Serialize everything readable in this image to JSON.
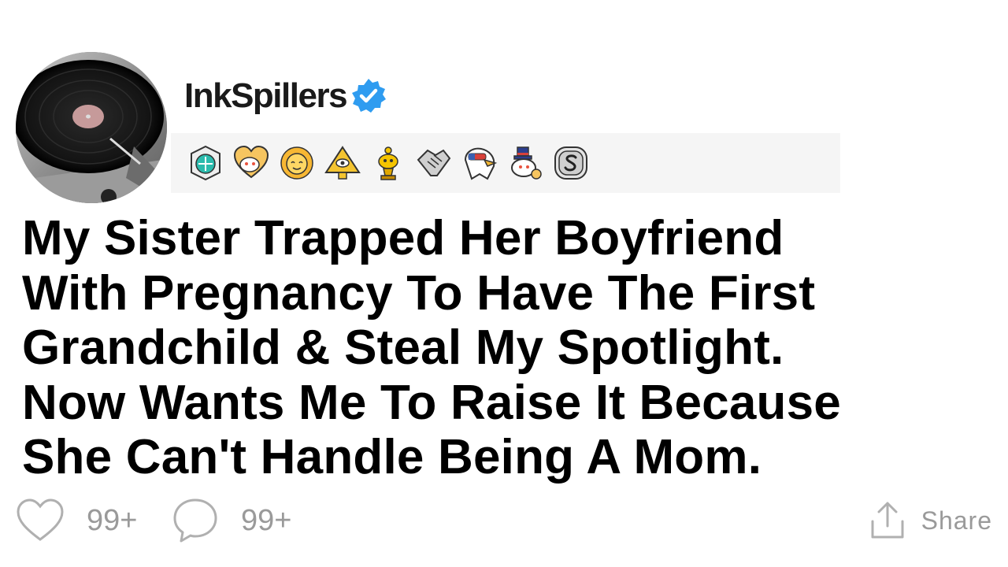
{
  "post": {
    "author": {
      "username": "InkSpillers",
      "verified": true,
      "avatar_icon": "record-player-avatar"
    },
    "awards": [
      {
        "name": "helpful-award-icon"
      },
      {
        "name": "wholesome-heart-award-icon"
      },
      {
        "name": "happy-sun-award-icon"
      },
      {
        "name": "illuminati-pyramid-award-icon"
      },
      {
        "name": "gold-trophy-award-icon"
      },
      {
        "name": "handshake-award-icon"
      },
      {
        "name": "eagle-award-icon"
      },
      {
        "name": "snoo-top-hat-award-icon"
      },
      {
        "name": "silver-coin-award-icon"
      }
    ],
    "title_lines": [
      "My Sister Trapped Her Boyfriend",
      "With Pregnancy To Have The First",
      "Grandchild & Steal My Spotlight.",
      "Now Wants Me To Raise It Because",
      "She Can't Handle Being A Mom."
    ],
    "likes": "99+",
    "comments": "99+",
    "share_label": "Share"
  },
  "colors": {
    "verified_blue": "#2f9cf0",
    "muted_gray": "#9a9a9a",
    "award_bar": "#f5f5f5"
  }
}
